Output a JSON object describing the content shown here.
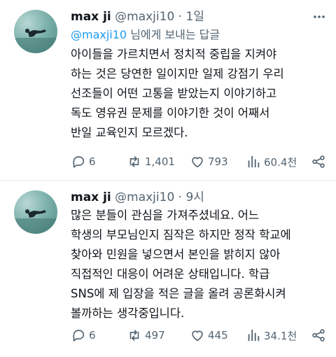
{
  "tweets": [
    {
      "author_name": "max ji",
      "handle_time": "@maxji10 · 1일",
      "reply_to": {
        "handle": "@maxji10",
        "suffix": " 님에게 보내는 답글"
      },
      "lines": [
        "아이들을 가르치면서 정치적 중립을 지켜야",
        "하는 것은 당연한 일이지만 일제 강점기 우리",
        "선조들이 어떤 고통을 받았는지 이야기하고",
        "독도 영유권 문제를 이야기한 것이 어째서",
        "반일 교육인지 모르겠다."
      ],
      "stats": {
        "replies": "6",
        "retweets": "1,401",
        "likes": "793",
        "views": "60.4천"
      }
    },
    {
      "author_name": "max ji",
      "handle_time": "@maxji10 · 9시",
      "lines": [
        "많은 분들이 관심을 가져주셨네요. 어느",
        "학생의 부모님인지 짐작은 하지만 정작 학교에",
        "찾아와 민원을 넣으면서 본인을 밝히지 않아",
        "직접적인 대응이 어려운 상태입니다. 학급",
        "SNS에 제 입장을 적은 글을 올려 공론화시켜",
        "볼까하는 생각중입니다."
      ],
      "stats": {
        "replies": "6",
        "retweets": "497",
        "likes": "445",
        "views": "34.1천"
      }
    }
  ],
  "icons": {
    "more": "more-dots-icon",
    "reply": "reply-bubble-icon",
    "retweet": "retweet-icon",
    "like": "heart-icon",
    "views": "views-bar-chart-icon",
    "share": "share-icon"
  },
  "colors": {
    "text": "#0f1419",
    "muted": "#536471",
    "link": "#1d9bf0",
    "divider": "#e6e8ea"
  }
}
